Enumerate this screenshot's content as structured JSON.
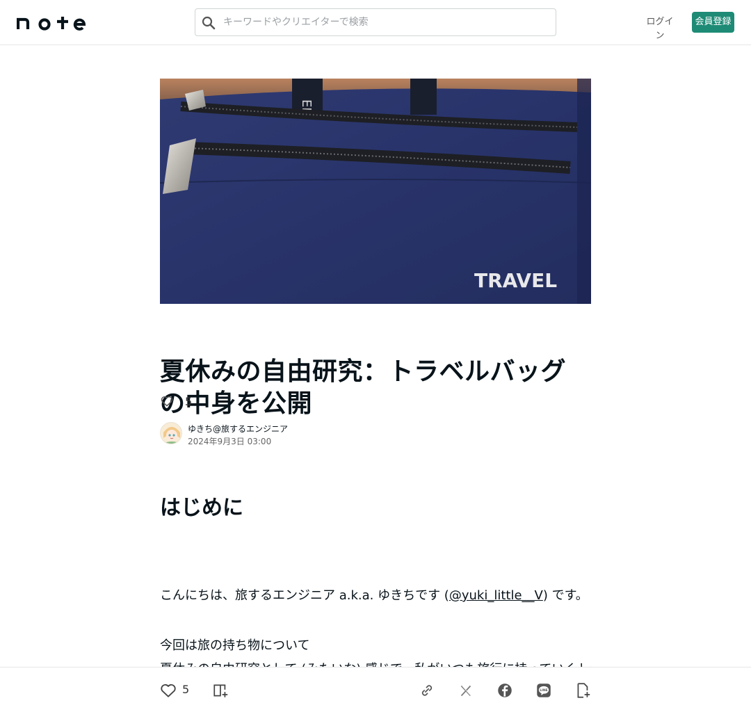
{
  "header": {
    "logo_text": "note",
    "search_placeholder": "キーワードやクリエイターで検索",
    "login_label": "ログイン",
    "signup_label": "会員登録"
  },
  "hero": {
    "image_text": "TRAVEL"
  },
  "article": {
    "title": "夏休みの自由研究：トラベルバッグの中身を公開",
    "like_count": "5",
    "author_name": "ゆきち@旅するエンジニア",
    "date": "2024年9月3日 03:00",
    "section_heading": "はじめに",
    "para1_prefix": "こんにちは、旅するエンジニア a.k.a. ゆきちです (",
    "para1_link": "@yuki_little__V",
    "para1_suffix": ") です。",
    "para2": "今回は旅の持ち物について",
    "para3": "夏休みの自由研究として (みたいな) 感じで、私がいつも旅行に持っていくトラベルバッグの中身を公開します。いろいろと試行錯誤"
  },
  "bottom_bar": {
    "like_count": "5",
    "icons": [
      "heart-icon",
      "magazine-add-icon",
      "link-icon",
      "x-icon",
      "facebook-icon",
      "line-icon",
      "note-add-icon"
    ]
  },
  "colors": {
    "accent": "#1e8b76",
    "text": "#08131a",
    "hero_bag": "#2a3568"
  }
}
